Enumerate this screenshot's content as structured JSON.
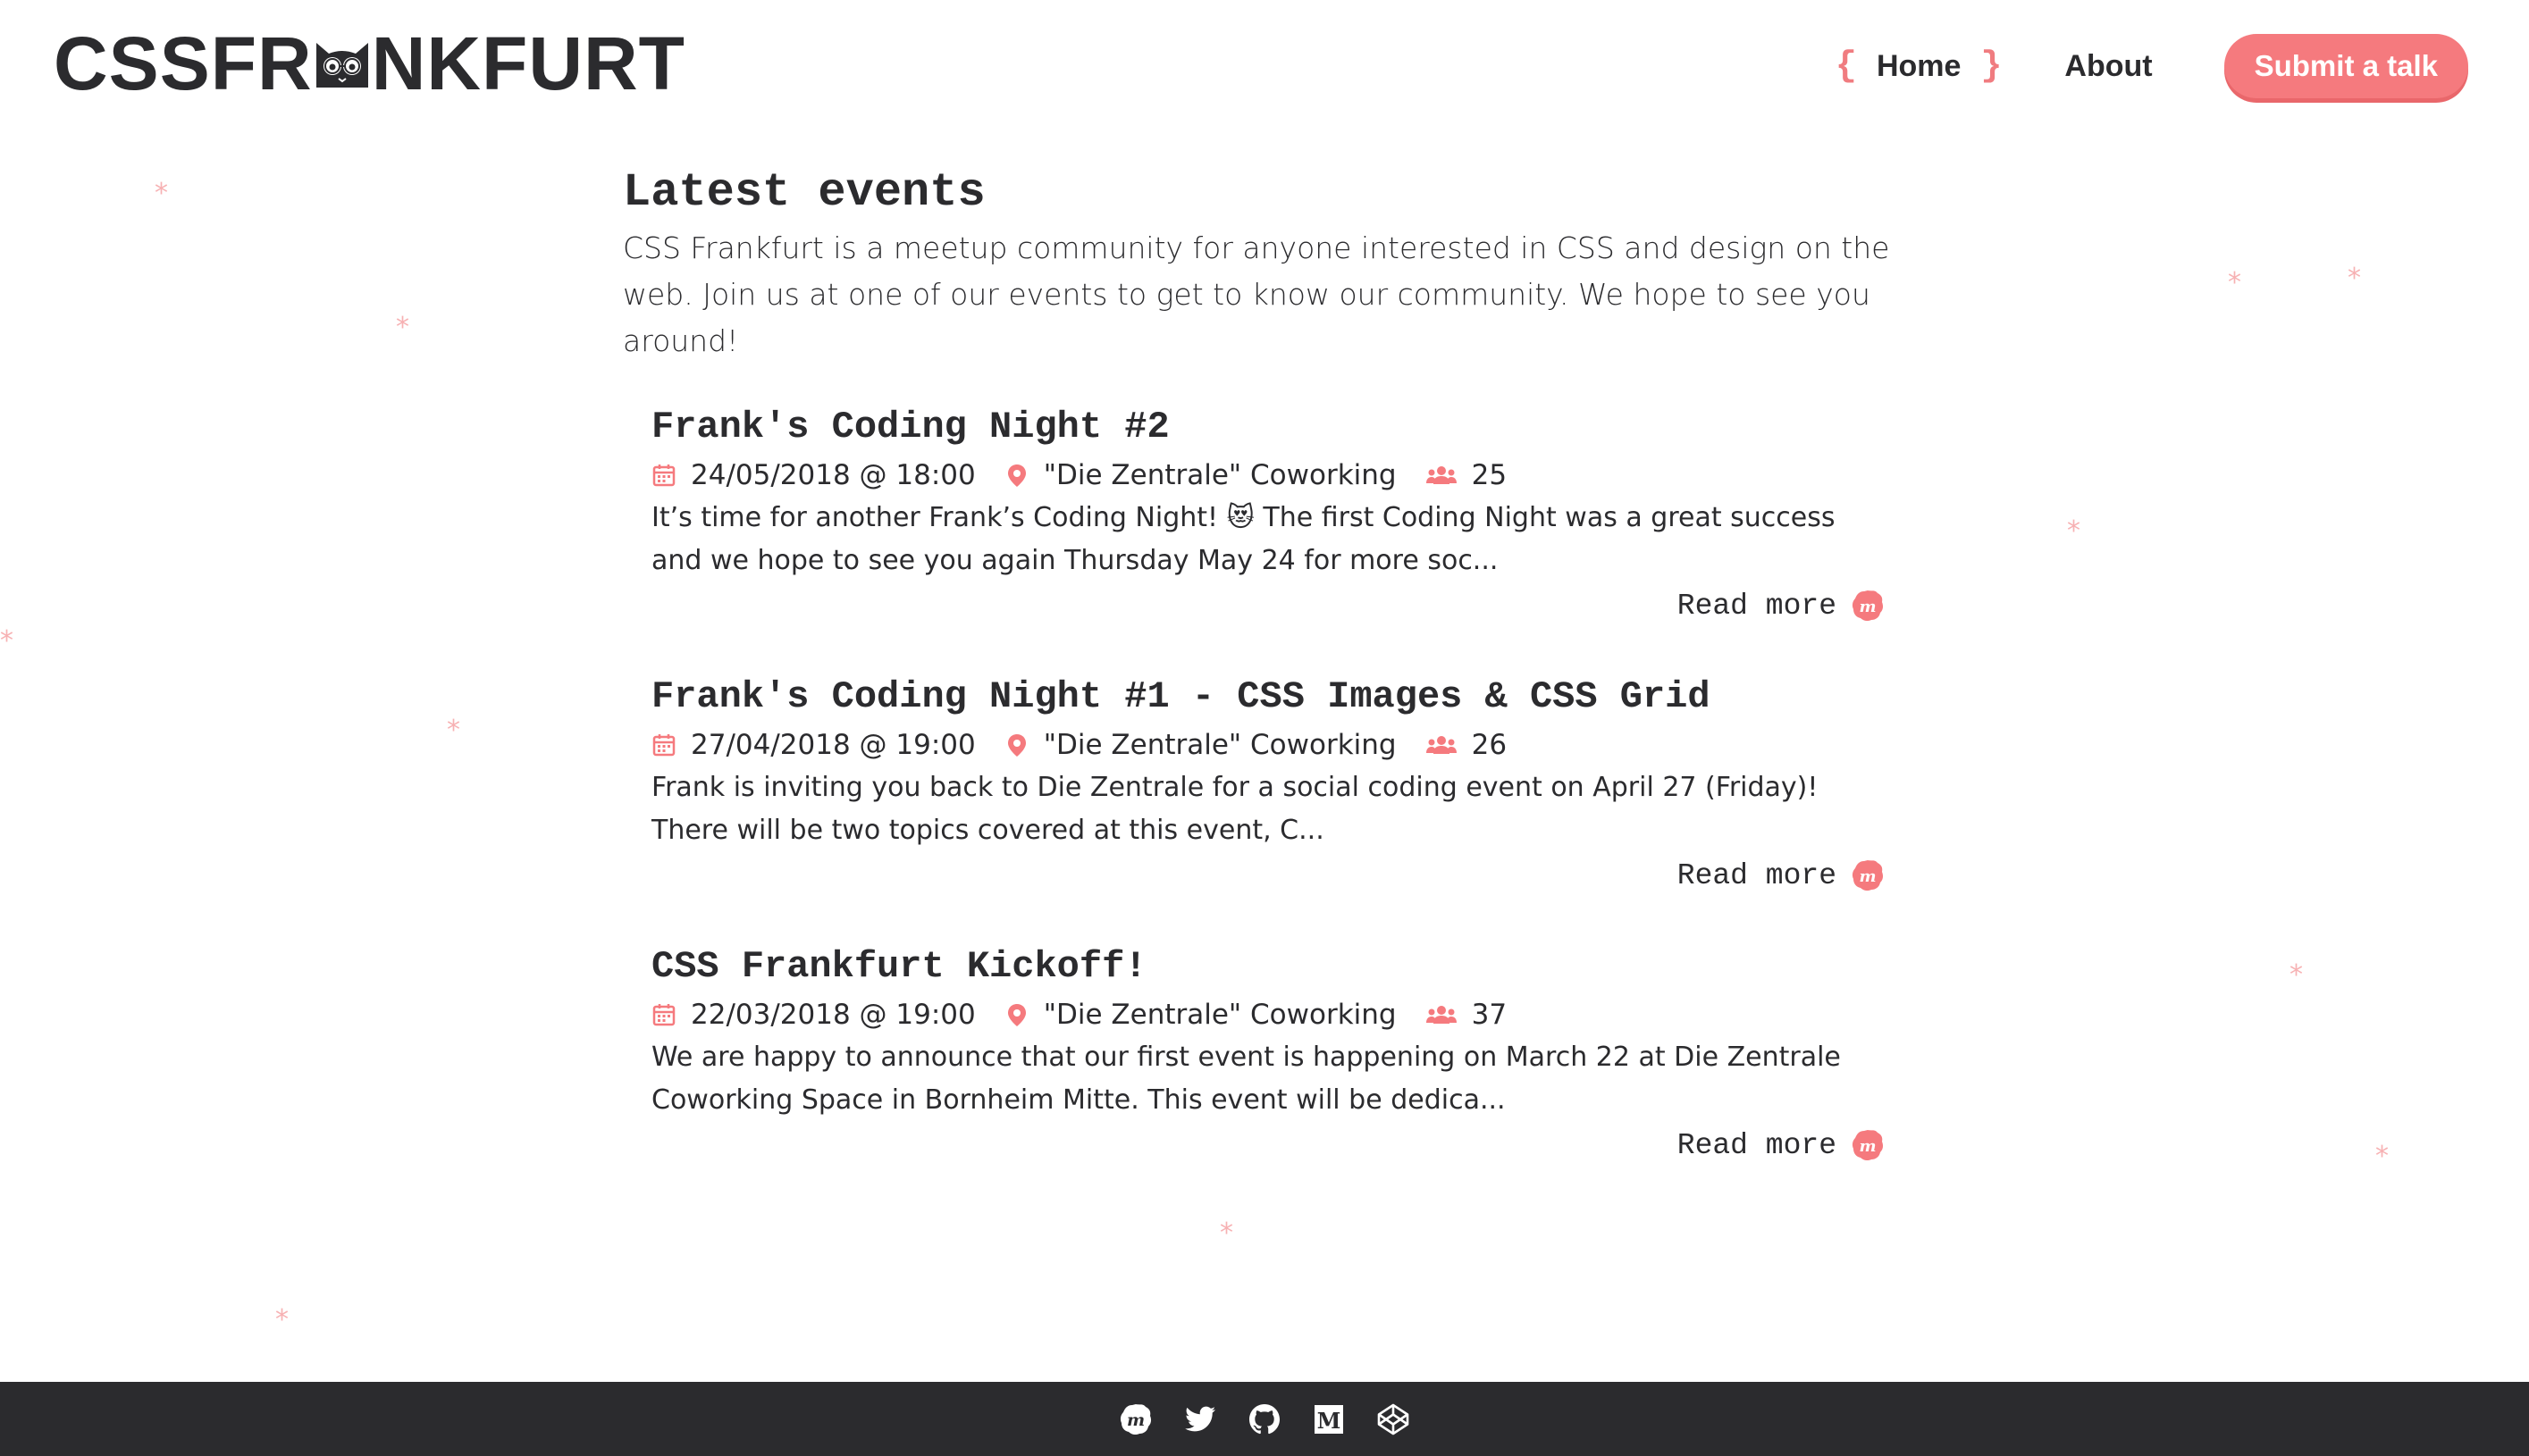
{
  "header": {
    "logo_left": "CSSFR",
    "logo_right": "NKFURT",
    "nav": {
      "home": "Home",
      "brace_open": "{",
      "brace_close": "}",
      "about": "About",
      "submit": "Submit a talk"
    }
  },
  "main": {
    "title": "Latest events",
    "intro": "CSS Frankfurt is a meetup community for anyone interested in CSS and design on the web. Join us at one of our events to get to know our community. We hope to see you around!",
    "events": [
      {
        "title": "Frank's Coding Night #2",
        "date": "24/05/2018 @ 18:00",
        "location": "\"Die Zentrale\" Coworking",
        "attendees": "25",
        "description": "It’s time for another Frank’s Coding Night! 😻 The first Coding Night was a great success and we hope to see you again Thursday May 24 for more soc...",
        "read_more": "Read more"
      },
      {
        "title": "Frank's Coding Night #1 - CSS Images & CSS Grid",
        "date": "27/04/2018 @ 19:00",
        "location": "\"Die Zentrale\" Coworking",
        "attendees": "26",
        "description": "Frank is inviting you back to Die Zentrale for a social coding event on April 27 (Friday)! There will be two topics covered at this event, C...",
        "read_more": "Read more"
      },
      {
        "title": "CSS Frankfurt Kickoff!",
        "date": "22/03/2018 @ 19:00",
        "location": "\"Die Zentrale\" Coworking",
        "attendees": "37",
        "description": "We are happy to announce that our first event is happening on March 22 at Die Zentrale Coworking Space in Bornheim Mitte. This event will be dedica...",
        "read_more": "Read more"
      }
    ]
  },
  "footer": {
    "icons": [
      "meetup-icon",
      "twitter-icon",
      "github-icon",
      "medium-icon",
      "codepen-icon"
    ]
  },
  "colors": {
    "accent": "#f57a7e",
    "text": "#2b2b2e",
    "footer_bg": "#2b2b2e",
    "star": "#f7b1b3"
  }
}
